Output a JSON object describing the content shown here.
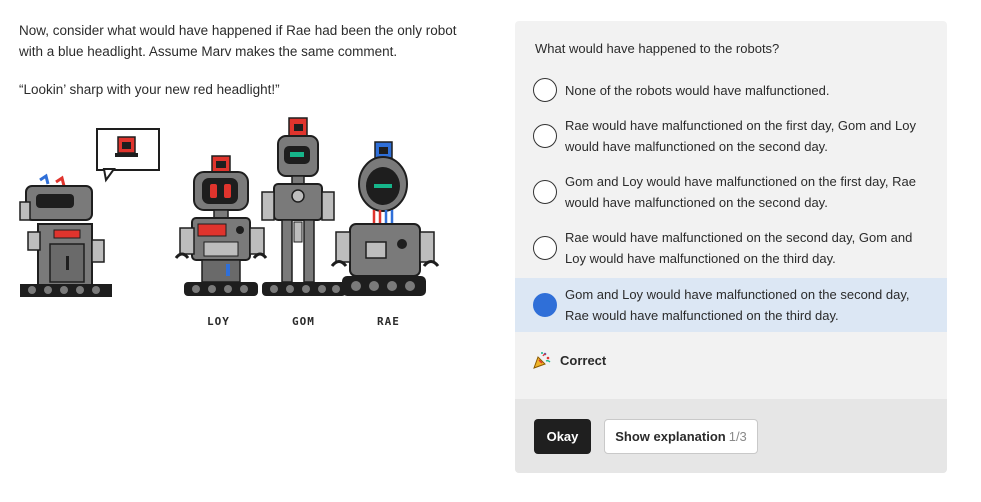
{
  "prompt": {
    "line1": "Now, consider what would have happened if Rae had been the only robot",
    "line2": "with a blue headlight. Assume Marv makes the same comment.",
    "quote": "“Lookin’ sharp with your new red headlight!”"
  },
  "illustration": {
    "labels": [
      "LOY",
      "GOM",
      "RAE"
    ],
    "colors": {
      "body": "#7a7a7a",
      "dark": "#1e1e1e",
      "red": "#e0342d",
      "blue": "#2f6fd8",
      "teal": "#16b58a",
      "light": "#bdbdbd"
    }
  },
  "panel": {
    "question": "What would have happened to the robots?",
    "options": [
      {
        "text": "None of the robots would have malfunctioned.",
        "selected": false
      },
      {
        "text": "Rae would have malfunctioned on the first day, Gom and Loy would have malfunctioned on the second day.",
        "selected": false
      },
      {
        "text": "Gom and Loy would have malfunctioned on the first day, Rae would have malfunctioned on the second day.",
        "selected": false
      },
      {
        "text": "Rae would have malfunctioned on the second day, Gom and Loy would have malfunctioned on the third day.",
        "selected": false
      },
      {
        "text": "Gom and Loy would have malfunctioned on the second day, Rae would have malfunctioned on the third day.",
        "selected": true
      }
    ],
    "feedback": {
      "icon": "party-popper-icon",
      "text": "Correct"
    },
    "buttons": {
      "okay": "Okay",
      "explain": "Show explanation",
      "explain_count": "1/3"
    },
    "colors": {
      "selected_bg": "#dce7f4",
      "accent": "#2f6fd8",
      "footer_bg": "#e6e6e6"
    }
  }
}
